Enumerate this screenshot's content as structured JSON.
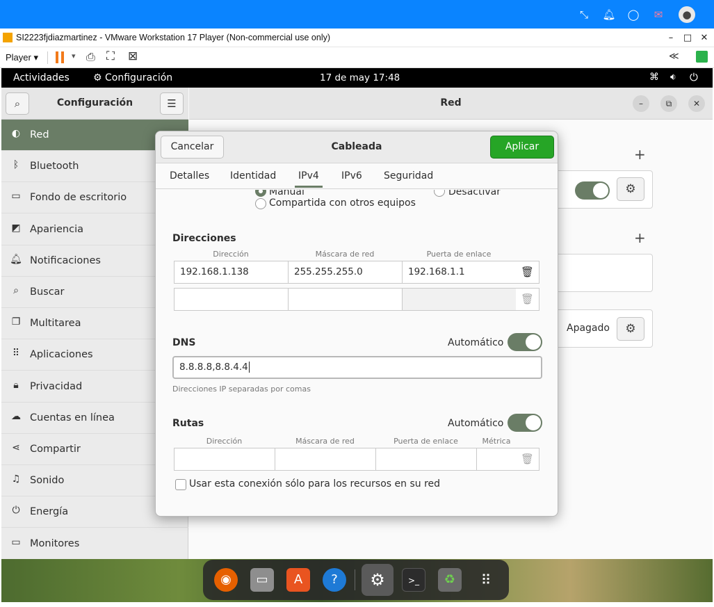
{
  "vmware": {
    "window_title": "SI2223fjdiazmartinez - VMware Workstation 17 Player (Non-commercial use only)",
    "player_menu": "Player"
  },
  "ubuntu_bar": {
    "activities": "Actividades",
    "app_name": "Configuración",
    "clock": "17 de may  17:48"
  },
  "sidebar": {
    "title": "Configuración",
    "items": [
      {
        "label": "Red",
        "icon": "network-icon"
      },
      {
        "label": "Bluetooth",
        "icon": "bluetooth-icon"
      },
      {
        "label": "Fondo de escritorio",
        "icon": "background-icon"
      },
      {
        "label": "Apariencia",
        "icon": "appearance-icon"
      },
      {
        "label": "Notificaciones",
        "icon": "bell-icon"
      },
      {
        "label": "Buscar",
        "icon": "search-icon"
      },
      {
        "label": "Multitarea",
        "icon": "multitask-icon"
      },
      {
        "label": "Aplicaciones",
        "icon": "apps-grid-icon"
      },
      {
        "label": "Privacidad",
        "icon": "lock-icon"
      },
      {
        "label": "Cuentas en línea",
        "icon": "cloud-icon"
      },
      {
        "label": "Compartir",
        "icon": "share-icon"
      },
      {
        "label": "Sonido",
        "icon": "music-note-icon"
      },
      {
        "label": "Energía",
        "icon": "power-icon"
      },
      {
        "label": "Monitores",
        "icon": "display-icon"
      }
    ]
  },
  "main": {
    "title": "Red",
    "off_status": "Apagado"
  },
  "dialog": {
    "title": "Cableada",
    "cancel": "Cancelar",
    "apply": "Aplicar",
    "tabs": [
      "Detalles",
      "Identidad",
      "IPv4",
      "IPv6",
      "Seguridad"
    ],
    "selected_tab": "IPv4",
    "method_manual": "Manual",
    "method_disable": "Desactivar",
    "method_shared": "Compartida con otros equipos",
    "addresses": {
      "heading": "Direcciones",
      "columns": [
        "Dirección",
        "Máscara de red",
        "Puerta de enlace"
      ],
      "rows": [
        [
          "192.168.1.138",
          "255.255.255.0",
          "192.168.1.1"
        ],
        [
          "",
          "",
          ""
        ]
      ]
    },
    "dns": {
      "heading": "DNS",
      "auto_label": "Automático",
      "auto_on": true,
      "value": "8.8.8.8,8.8.4.4",
      "hint": "Direcciones IP separadas por comas"
    },
    "routes": {
      "heading": "Rutas",
      "auto_label": "Automático",
      "auto_on": true,
      "columns": [
        "Dirección",
        "Máscara de red",
        "Puerta de enlace",
        "Métrica"
      ]
    },
    "only_local": "Usar esta conexión sólo para los recursos en su red"
  },
  "colors": {
    "host_bar": "#0a84ff",
    "accent": "#6a7d66",
    "apply_green": "#26a526"
  }
}
